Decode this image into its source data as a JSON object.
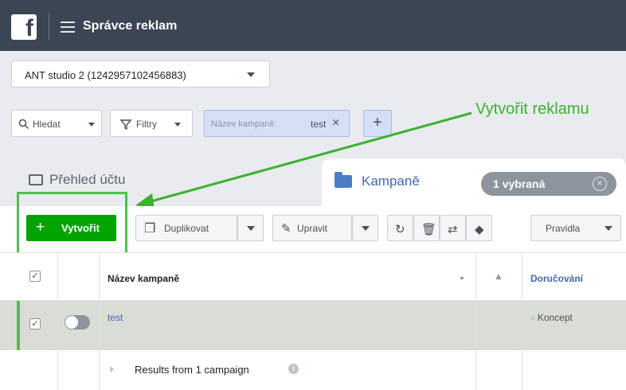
{
  "topbar": {
    "logo_letter": "f",
    "app_title": "Správce reklam"
  },
  "account": {
    "name": "ANT studio 2 (1242957102456883)"
  },
  "filters": {
    "search_label": "Hledat",
    "filters_label": "Filtry",
    "chip_key": "Název kampaně:",
    "chip_value": "test",
    "add_label": "+"
  },
  "annotation": {
    "label": "Vytvořit reklamu",
    "color": "#3cb22f"
  },
  "tabs": {
    "overview_label": "Přehled účtu",
    "campaigns_label": "Kampaně",
    "selected_label": "1 vybraná"
  },
  "toolbar": {
    "create_label": "Vytvořit",
    "duplicate_label": "Duplikovat",
    "edit_label": "Upravit",
    "rules_label": "Pravidla"
  },
  "table": {
    "columns": {
      "name": "Název kampaně",
      "delivery": "Doručování"
    },
    "rows": [
      {
        "name": "test",
        "status": "Koncept",
        "selected": true
      }
    ],
    "results_label": "Results from 1 campaign"
  },
  "colors": {
    "topbar": "#3b4553",
    "accent": "#4267b2",
    "create": "#00a400",
    "highlight": "#4ec04e"
  }
}
